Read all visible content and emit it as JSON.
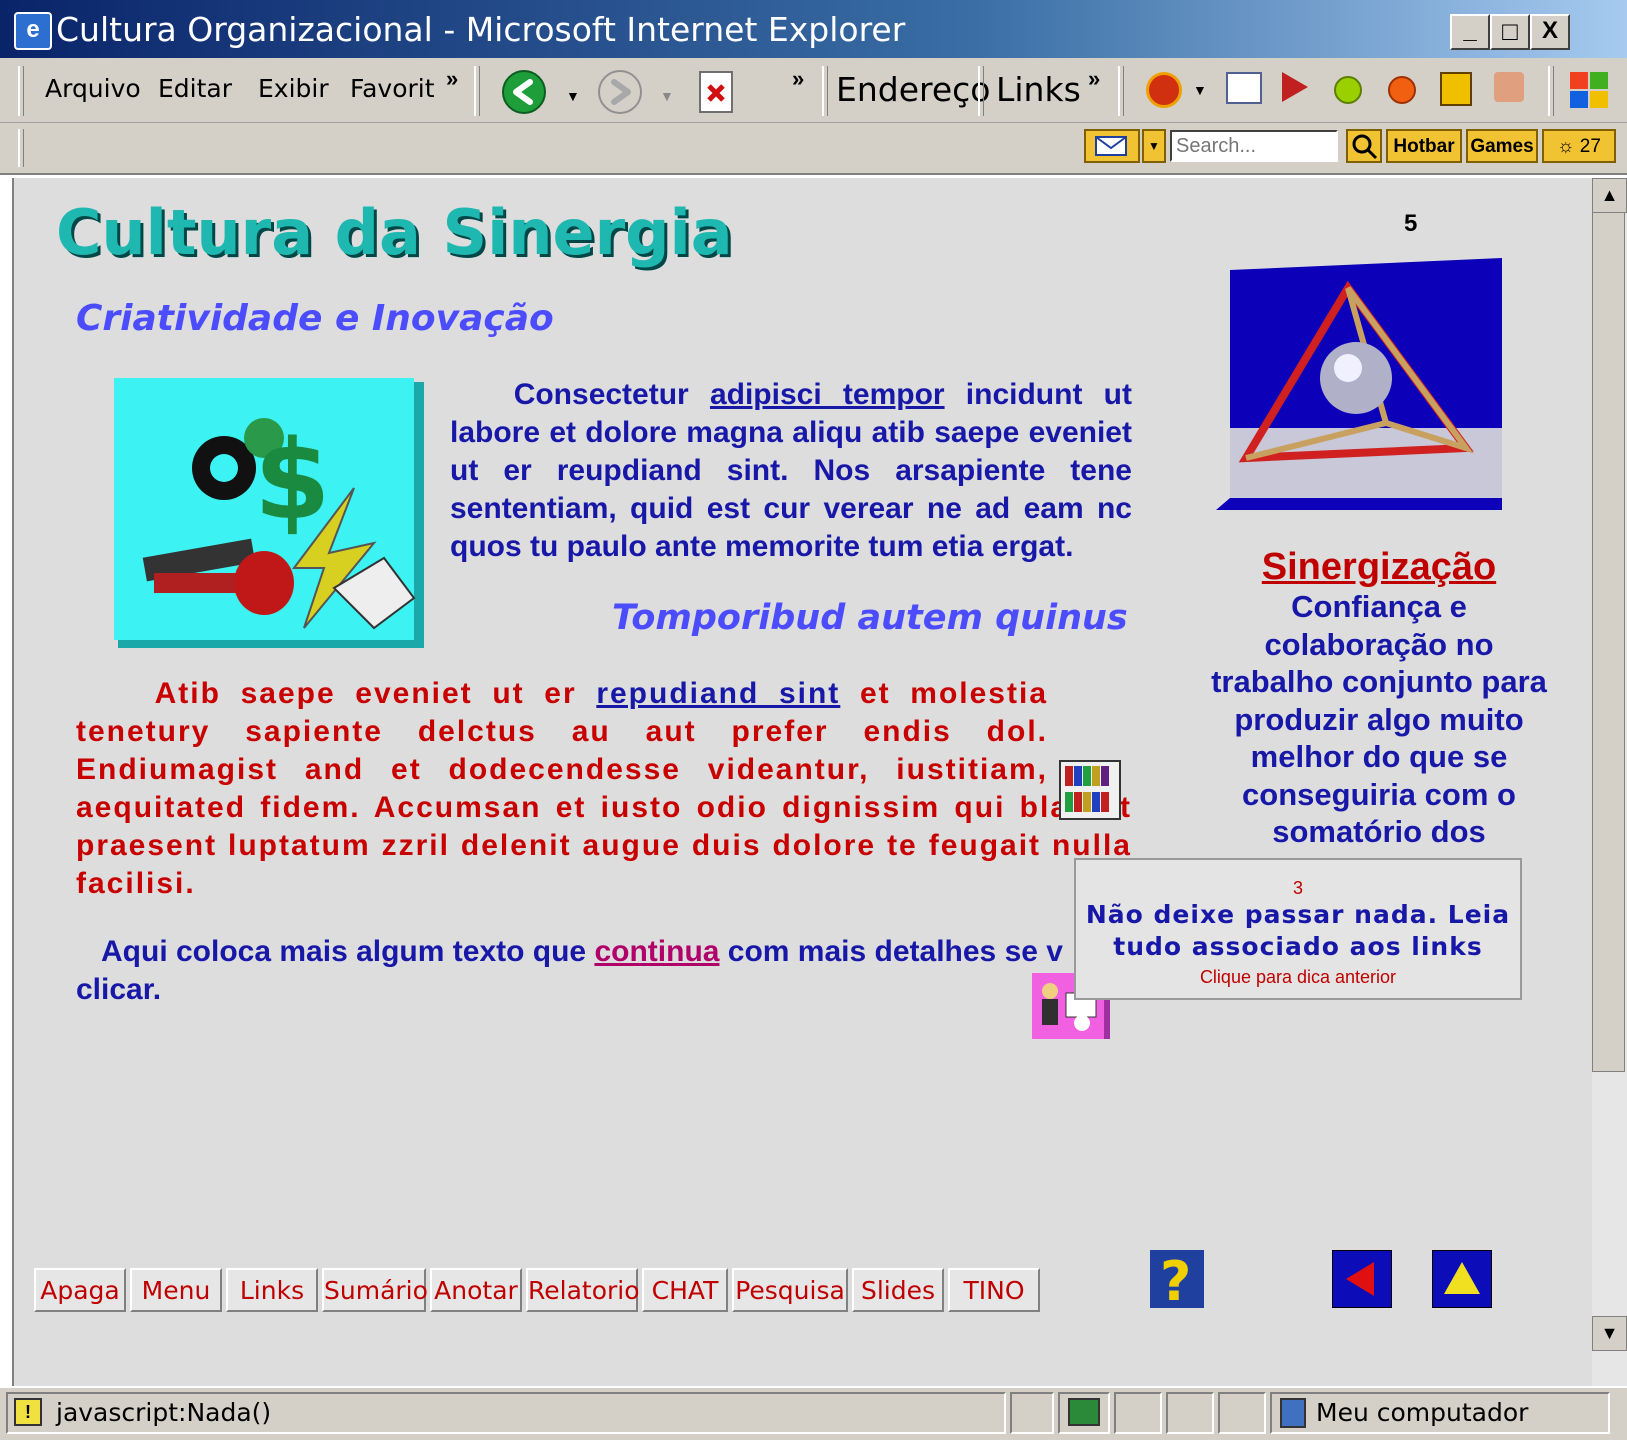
{
  "window": {
    "title": "Cultura Organizacional - Microsoft Internet Explorer",
    "minimize": "_",
    "maximize": "□",
    "close": "X"
  },
  "menu": {
    "items": [
      "Arquivo",
      "Editar",
      "Exibir",
      "Favorit"
    ],
    "overflow": "»"
  },
  "toolbar": {
    "address_label": "Endereço",
    "links_label": "Links",
    "overflow": "»",
    "search_placeholder": "Search...",
    "hotbar_label": "Hotbar",
    "games_label": "Games",
    "weather_label": "☼ 27"
  },
  "content": {
    "title": "Cultura da Sinergia",
    "subtitle1": "Criatividade e Inovação",
    "para1": {
      "pre": "Consectetur ",
      "link": "adipisci tempor",
      "post": " incidunt ut labore et dolore magna aliqu atib saepe eveniet ut er reupdiand sint. Nos arsapiente tene sententiam, quid est cur verear ne ad eam nc quos tu paulo ante memorite tum etia ergat."
    },
    "subtitle2": "Tomporibud autem quinus",
    "para2": {
      "pre": "Atib saepe eveniet ut er ",
      "link": "repudiand sint",
      "post": " et molestia tenetury sapiente delctus au aut prefer endis dol. Endiumagist and et dodecendesse videantur, iustitiam, aequitated fidem. Accumsan et iusto odio dignissim qui blandit praesent luptatum zzril delenit augue duis dolore te feugait nulla facilisi."
    },
    "para3": {
      "pre": "Aqui coloca mais algum texto que ",
      "link": "continua",
      "post": " com mais detalhes se v",
      "line2": "clicar."
    }
  },
  "sidebar": {
    "number": "5",
    "title": "Sinergização",
    "text": "Confiança e colaboração no trabalho conjunto para produzir algo muito melhor do que se conseguiria com o somatório dos resultados em"
  },
  "tip": {
    "number": "3",
    "text": "Não deixe passar nada. Leia tudo associado aos links",
    "link": "Clique para dica anterior"
  },
  "nav_buttons": [
    "Apaga",
    "Menu",
    "Links",
    "Sumário",
    "Anotar",
    "Relatorio",
    "CHAT",
    "Pesquisa",
    "Slides",
    "TINO"
  ],
  "statusbar": {
    "text": "javascript:Nada()",
    "zone": "Meu computador"
  },
  "colors": {
    "title_bar": "#0a246a",
    "heading": "#1eb8b0",
    "blue_text": "#1818a8",
    "red_text": "#c80000",
    "subtitle": "#4c4cff"
  }
}
